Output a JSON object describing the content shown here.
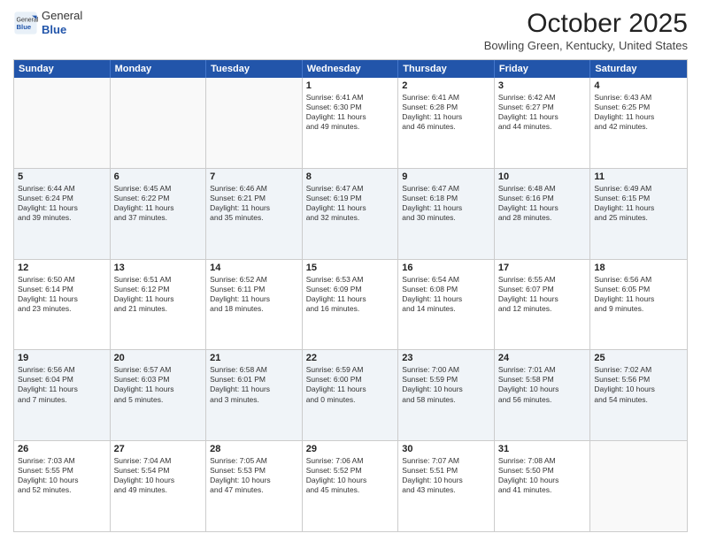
{
  "logo": {
    "general": "General",
    "blue": "Blue"
  },
  "title": "October 2025",
  "location": "Bowling Green, Kentucky, United States",
  "days_of_week": [
    "Sunday",
    "Monday",
    "Tuesday",
    "Wednesday",
    "Thursday",
    "Friday",
    "Saturday"
  ],
  "rows": [
    {
      "alt": false,
      "cells": [
        {
          "day": "",
          "lines": []
        },
        {
          "day": "",
          "lines": []
        },
        {
          "day": "",
          "lines": []
        },
        {
          "day": "1",
          "lines": [
            "Sunrise: 6:41 AM",
            "Sunset: 6:30 PM",
            "Daylight: 11 hours",
            "and 49 minutes."
          ]
        },
        {
          "day": "2",
          "lines": [
            "Sunrise: 6:41 AM",
            "Sunset: 6:28 PM",
            "Daylight: 11 hours",
            "and 46 minutes."
          ]
        },
        {
          "day": "3",
          "lines": [
            "Sunrise: 6:42 AM",
            "Sunset: 6:27 PM",
            "Daylight: 11 hours",
            "and 44 minutes."
          ]
        },
        {
          "day": "4",
          "lines": [
            "Sunrise: 6:43 AM",
            "Sunset: 6:25 PM",
            "Daylight: 11 hours",
            "and 42 minutes."
          ]
        }
      ]
    },
    {
      "alt": true,
      "cells": [
        {
          "day": "5",
          "lines": [
            "Sunrise: 6:44 AM",
            "Sunset: 6:24 PM",
            "Daylight: 11 hours",
            "and 39 minutes."
          ]
        },
        {
          "day": "6",
          "lines": [
            "Sunrise: 6:45 AM",
            "Sunset: 6:22 PM",
            "Daylight: 11 hours",
            "and 37 minutes."
          ]
        },
        {
          "day": "7",
          "lines": [
            "Sunrise: 6:46 AM",
            "Sunset: 6:21 PM",
            "Daylight: 11 hours",
            "and 35 minutes."
          ]
        },
        {
          "day": "8",
          "lines": [
            "Sunrise: 6:47 AM",
            "Sunset: 6:19 PM",
            "Daylight: 11 hours",
            "and 32 minutes."
          ]
        },
        {
          "day": "9",
          "lines": [
            "Sunrise: 6:47 AM",
            "Sunset: 6:18 PM",
            "Daylight: 11 hours",
            "and 30 minutes."
          ]
        },
        {
          "day": "10",
          "lines": [
            "Sunrise: 6:48 AM",
            "Sunset: 6:16 PM",
            "Daylight: 11 hours",
            "and 28 minutes."
          ]
        },
        {
          "day": "11",
          "lines": [
            "Sunrise: 6:49 AM",
            "Sunset: 6:15 PM",
            "Daylight: 11 hours",
            "and 25 minutes."
          ]
        }
      ]
    },
    {
      "alt": false,
      "cells": [
        {
          "day": "12",
          "lines": [
            "Sunrise: 6:50 AM",
            "Sunset: 6:14 PM",
            "Daylight: 11 hours",
            "and 23 minutes."
          ]
        },
        {
          "day": "13",
          "lines": [
            "Sunrise: 6:51 AM",
            "Sunset: 6:12 PM",
            "Daylight: 11 hours",
            "and 21 minutes."
          ]
        },
        {
          "day": "14",
          "lines": [
            "Sunrise: 6:52 AM",
            "Sunset: 6:11 PM",
            "Daylight: 11 hours",
            "and 18 minutes."
          ]
        },
        {
          "day": "15",
          "lines": [
            "Sunrise: 6:53 AM",
            "Sunset: 6:09 PM",
            "Daylight: 11 hours",
            "and 16 minutes."
          ]
        },
        {
          "day": "16",
          "lines": [
            "Sunrise: 6:54 AM",
            "Sunset: 6:08 PM",
            "Daylight: 11 hours",
            "and 14 minutes."
          ]
        },
        {
          "day": "17",
          "lines": [
            "Sunrise: 6:55 AM",
            "Sunset: 6:07 PM",
            "Daylight: 11 hours",
            "and 12 minutes."
          ]
        },
        {
          "day": "18",
          "lines": [
            "Sunrise: 6:56 AM",
            "Sunset: 6:05 PM",
            "Daylight: 11 hours",
            "and 9 minutes."
          ]
        }
      ]
    },
    {
      "alt": true,
      "cells": [
        {
          "day": "19",
          "lines": [
            "Sunrise: 6:56 AM",
            "Sunset: 6:04 PM",
            "Daylight: 11 hours",
            "and 7 minutes."
          ]
        },
        {
          "day": "20",
          "lines": [
            "Sunrise: 6:57 AM",
            "Sunset: 6:03 PM",
            "Daylight: 11 hours",
            "and 5 minutes."
          ]
        },
        {
          "day": "21",
          "lines": [
            "Sunrise: 6:58 AM",
            "Sunset: 6:01 PM",
            "Daylight: 11 hours",
            "and 3 minutes."
          ]
        },
        {
          "day": "22",
          "lines": [
            "Sunrise: 6:59 AM",
            "Sunset: 6:00 PM",
            "Daylight: 11 hours",
            "and 0 minutes."
          ]
        },
        {
          "day": "23",
          "lines": [
            "Sunrise: 7:00 AM",
            "Sunset: 5:59 PM",
            "Daylight: 10 hours",
            "and 58 minutes."
          ]
        },
        {
          "day": "24",
          "lines": [
            "Sunrise: 7:01 AM",
            "Sunset: 5:58 PM",
            "Daylight: 10 hours",
            "and 56 minutes."
          ]
        },
        {
          "day": "25",
          "lines": [
            "Sunrise: 7:02 AM",
            "Sunset: 5:56 PM",
            "Daylight: 10 hours",
            "and 54 minutes."
          ]
        }
      ]
    },
    {
      "alt": false,
      "cells": [
        {
          "day": "26",
          "lines": [
            "Sunrise: 7:03 AM",
            "Sunset: 5:55 PM",
            "Daylight: 10 hours",
            "and 52 minutes."
          ]
        },
        {
          "day": "27",
          "lines": [
            "Sunrise: 7:04 AM",
            "Sunset: 5:54 PM",
            "Daylight: 10 hours",
            "and 49 minutes."
          ]
        },
        {
          "day": "28",
          "lines": [
            "Sunrise: 7:05 AM",
            "Sunset: 5:53 PM",
            "Daylight: 10 hours",
            "and 47 minutes."
          ]
        },
        {
          "day": "29",
          "lines": [
            "Sunrise: 7:06 AM",
            "Sunset: 5:52 PM",
            "Daylight: 10 hours",
            "and 45 minutes."
          ]
        },
        {
          "day": "30",
          "lines": [
            "Sunrise: 7:07 AM",
            "Sunset: 5:51 PM",
            "Daylight: 10 hours",
            "and 43 minutes."
          ]
        },
        {
          "day": "31",
          "lines": [
            "Sunrise: 7:08 AM",
            "Sunset: 5:50 PM",
            "Daylight: 10 hours",
            "and 41 minutes."
          ]
        },
        {
          "day": "",
          "lines": []
        }
      ]
    }
  ]
}
